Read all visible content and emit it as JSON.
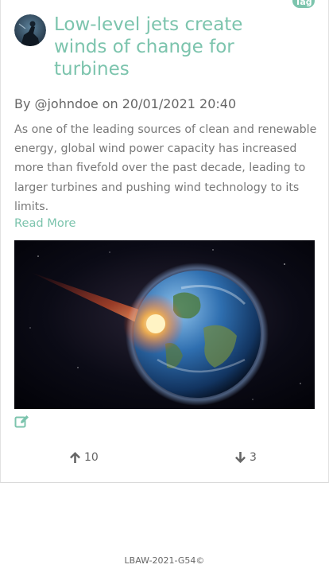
{
  "post": {
    "tag": "Tag",
    "title": "Low-level jets create winds of change for turbines",
    "by_prefix": "By",
    "author": "@johndoe",
    "on_word": "on",
    "date": "20/01/2021 20:40",
    "body": "As one of the leading sources of clean and renewable energy, global wind power capacity has increased more than fivefold over the past decade, leading to larger turbines and pushing wind technology to its limits.",
    "read_more": "Read More",
    "image_subject": "earth-asteroid-impact",
    "upvotes": "10",
    "downvotes": "3"
  },
  "icons": {
    "edit": "edit-icon",
    "upvote": "arrow-up-icon",
    "downvote": "arrow-down-icon"
  },
  "colors": {
    "accent": "#7cc4ad",
    "text": "#666666"
  },
  "footer": {
    "text": "LBAW-2021-G54©"
  }
}
